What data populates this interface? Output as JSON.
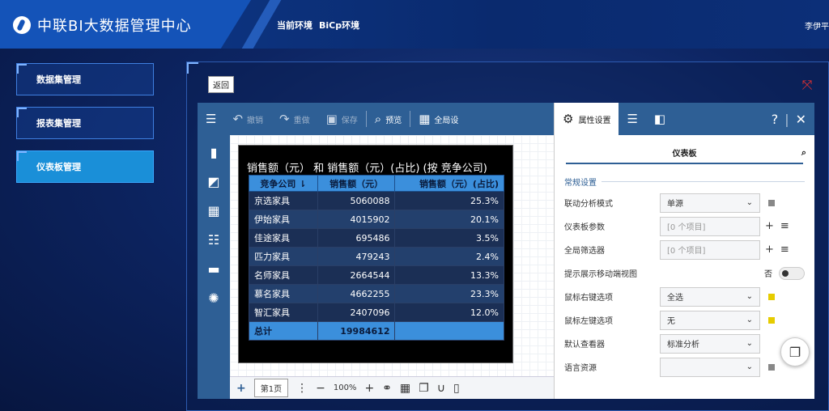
{
  "app": {
    "title": "中联BI大数据管理中心",
    "env_label": "当前环境",
    "env_value": "BiCp环境",
    "user": "李伊平"
  },
  "sidebar": {
    "items": [
      {
        "label": "数据集管理",
        "active": false
      },
      {
        "label": "报表集管理",
        "active": false
      },
      {
        "label": "仪表板管理",
        "active": true
      }
    ]
  },
  "main": {
    "back_label": "返回"
  },
  "toolbar": {
    "undo": "撤销",
    "redo": "重做",
    "save": "保存",
    "preview": "预览",
    "global": "全局设"
  },
  "panel": {
    "tab_props": "属性设置",
    "subtitle": "仪表板",
    "section": "常规设置",
    "rows": [
      {
        "label": "联动分析模式",
        "value": "单源"
      },
      {
        "label": "仪表板参数",
        "value": "[0 个项目]"
      },
      {
        "label": "全局筛选器",
        "value": "[0 个项目]"
      },
      {
        "label": "提示展示移动端视图",
        "value": "否"
      },
      {
        "label": "鼠标右键选项",
        "value": "全选"
      },
      {
        "label": "鼠标左键选项",
        "value": "无"
      },
      {
        "label": "默认查看器",
        "value": "标准分析"
      },
      {
        "label": "语言资源",
        "value": ""
      }
    ],
    "colors": {
      "active_dot": "#e6cc00",
      "muted_dot": "#888888"
    }
  },
  "widget": {
    "title": "销售额（元） 和 销售额（元）(占比) (按 竞争公司)",
    "headers": [
      "竞争公司",
      "销售额（元）",
      "销售额（元）(占比)"
    ],
    "rows": [
      [
        "京选家具",
        "5060088",
        "25.3%"
      ],
      [
        "伊始家具",
        "4015902",
        "20.1%"
      ],
      [
        "佳途家具",
        "695486",
        "3.5%"
      ],
      [
        "匹力家具",
        "479243",
        "2.4%"
      ],
      [
        "名师家具",
        "2664544",
        "13.3%"
      ],
      [
        "慕名家具",
        "4662255",
        "23.3%"
      ],
      [
        "智汇家具",
        "2407096",
        "12.0%"
      ]
    ],
    "total": [
      "总计",
      "19984612",
      ""
    ]
  },
  "bottombar": {
    "page": "第1页",
    "zoom": "100%"
  }
}
